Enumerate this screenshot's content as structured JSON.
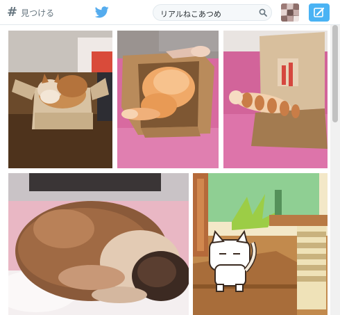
{
  "header": {
    "discover_label": "見つける",
    "search_value": "リアルねこあつめ",
    "icons": {
      "discover": "hashtag-icon",
      "brand": "twitter-bird-icon",
      "search": "search-icon",
      "compose": "compose-tweet-icon"
    }
  },
  "colors": {
    "brand_blue": "#55acee",
    "compose_blue": "#4ab3f4",
    "icon_gray": "#66757f"
  },
  "gallery": {
    "photos": [
      {
        "name": "cat-in-box-photo"
      },
      {
        "name": "cat-sleeping-in-box-photo"
      },
      {
        "name": "cat-tail-box-photo"
      },
      {
        "name": "siamese-cat-curled-photo"
      },
      {
        "name": "neko-atsume-cat-illustration"
      }
    ]
  }
}
